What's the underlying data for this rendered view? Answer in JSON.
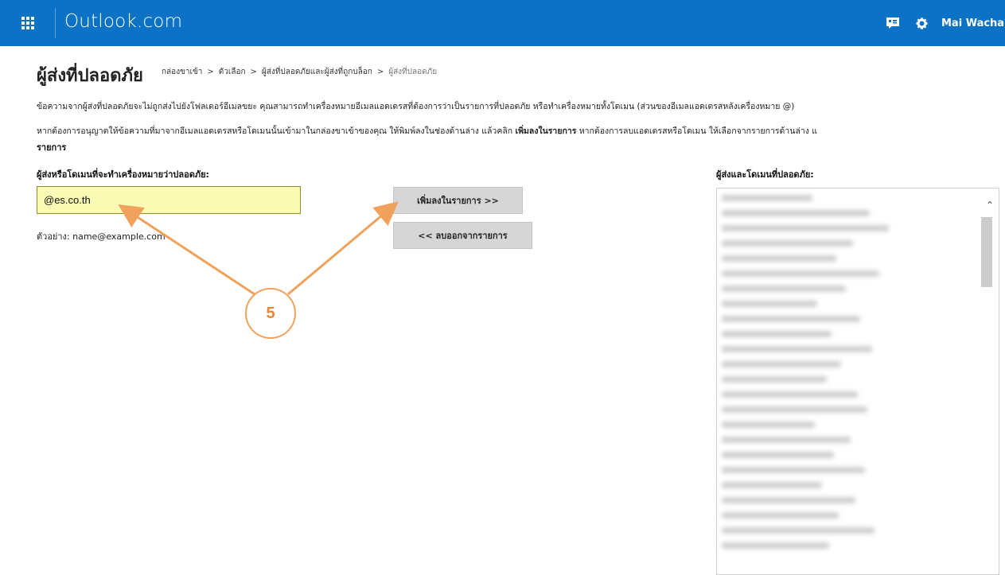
{
  "header": {
    "brand": "Outlook.com",
    "user_name": "Mai Wacha",
    "color": "#0b72c6"
  },
  "page": {
    "title": "ผู้ส่งที่ปลอดภัย",
    "breadcrumb": [
      "กล่องขาเข้า",
      ">",
      "ตัวเลือก",
      ">",
      "ผู้ส่งที่ปลอดภัยและผู้ส่งที่ถูกบล็อก",
      ">",
      "ผู้ส่งที่ปลอดภัย"
    ],
    "description_1": "ข้อความจากผู้ส่งที่ปลอดภัยจะไม่ถูกส่งไปยังโฟลเดอร์อีเมลขยะ คุณสามารถทำเครื่องหมายอีเมลแอดเดรสที่ต้องการว่าเป็นรายการที่ปลอดภัย หรือทำเครื่องหมายทั้งโดเมน (ส่วนของอีเมลแอดเดรสหลังเครื่องหมาย @)",
    "description_2_before": "หากต้องการอนุญาตให้ข้อความที่มาจากอีเมลแอดเดรสหรือโดเมนนั้นเข้ามาในกล่องขาเข้าของคุณ ให้พิมพ์ลงในช่องด้านล่าง แล้วคลิก ",
    "description_2_bold": "เพิ่มลงในรายการ",
    "description_2_after": "  หากต้องการลบแอดเดรสหรือโดเมน ให้เลือกจากรายการด้านล่าง แ",
    "description_2_line2": "รายการ"
  },
  "form": {
    "left_label": "ผู้ส่งหรือโดเมนที่จะทำเครื่องหมายว่าปลอดภัย:",
    "input_value": "@es.co.th",
    "example": "ตัวอย่าง: name@example.com",
    "add_button": "เพิ่มลงในรายการ >>",
    "remove_button": "<< ลบออกจากรายการ",
    "right_label": "ผู้ส่งและโดเมนที่ปลอดภัย:"
  },
  "annotation": {
    "step": "5",
    "color": "#f0a15c"
  }
}
